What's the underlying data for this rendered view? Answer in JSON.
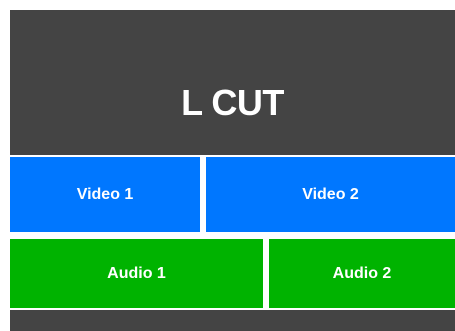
{
  "title": "L CUT",
  "tracks": {
    "video": [
      {
        "label": "Video 1"
      },
      {
        "label": "Video 2"
      }
    ],
    "audio": [
      {
        "label": "Audio 1"
      },
      {
        "label": "Audio 2"
      }
    ]
  },
  "colors": {
    "background": "#444444",
    "video": "#0077ff",
    "audio": "#00b300",
    "divider": "#ffffff",
    "text": "#ffffff"
  }
}
